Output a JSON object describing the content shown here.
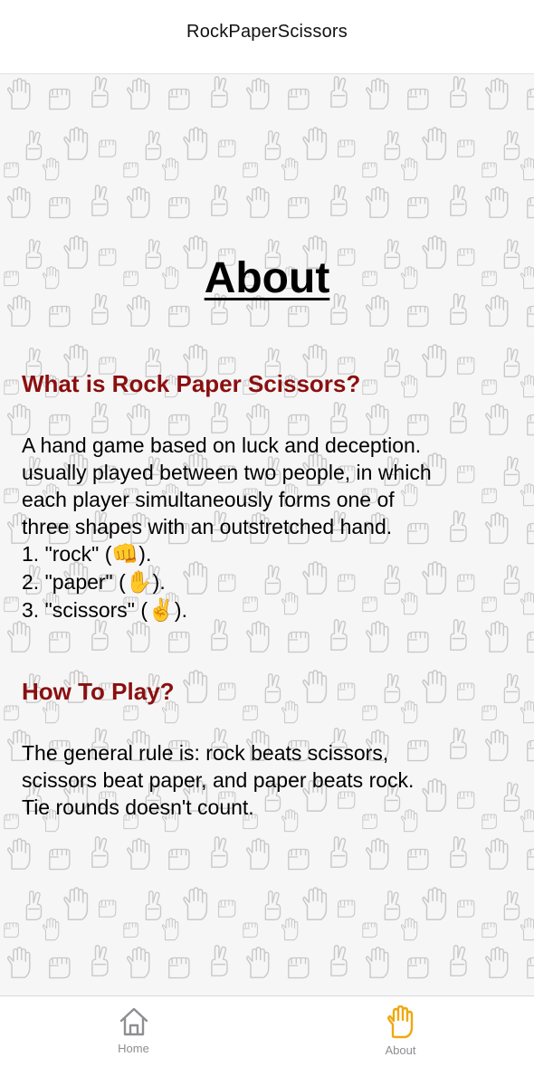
{
  "nav": {
    "title": "RockPaperScissors"
  },
  "page": {
    "title": "About",
    "sections": [
      {
        "heading": "What is Rock Paper Scissors?",
        "lines": [
          "A hand game based on luck and deception.",
          "usually played between two people, in which",
          "each player simultaneously forms one of",
          "three shapes with an outstretched hand."
        ],
        "list": [
          {
            "prefix": "1. \"rock\" (",
            "emoji": "👊",
            "suffix": ")."
          },
          {
            "prefix": "2. \"paper\" (",
            "emoji": "✋",
            "suffix": ")."
          },
          {
            "prefix": "3. \"scissors\" (",
            "emoji": "✌️",
            "suffix": ")."
          }
        ]
      },
      {
        "heading": "How To Play?",
        "lines": [
          "The general rule is: rock beats scissors,",
          "scissors beat paper, and paper beats rock.",
          "Tie rounds doesn't count."
        ]
      }
    ]
  },
  "tabs": [
    {
      "label": "Home",
      "icon": "home-icon",
      "active": false
    },
    {
      "label": "About",
      "icon": "hand-icon",
      "active": true
    }
  ],
  "colors": {
    "heading": "#8b0f0f",
    "active_tab_icon": "#f0a80f",
    "inactive_tab_icon": "#8e8e93",
    "pattern": "#c8c8c8"
  }
}
